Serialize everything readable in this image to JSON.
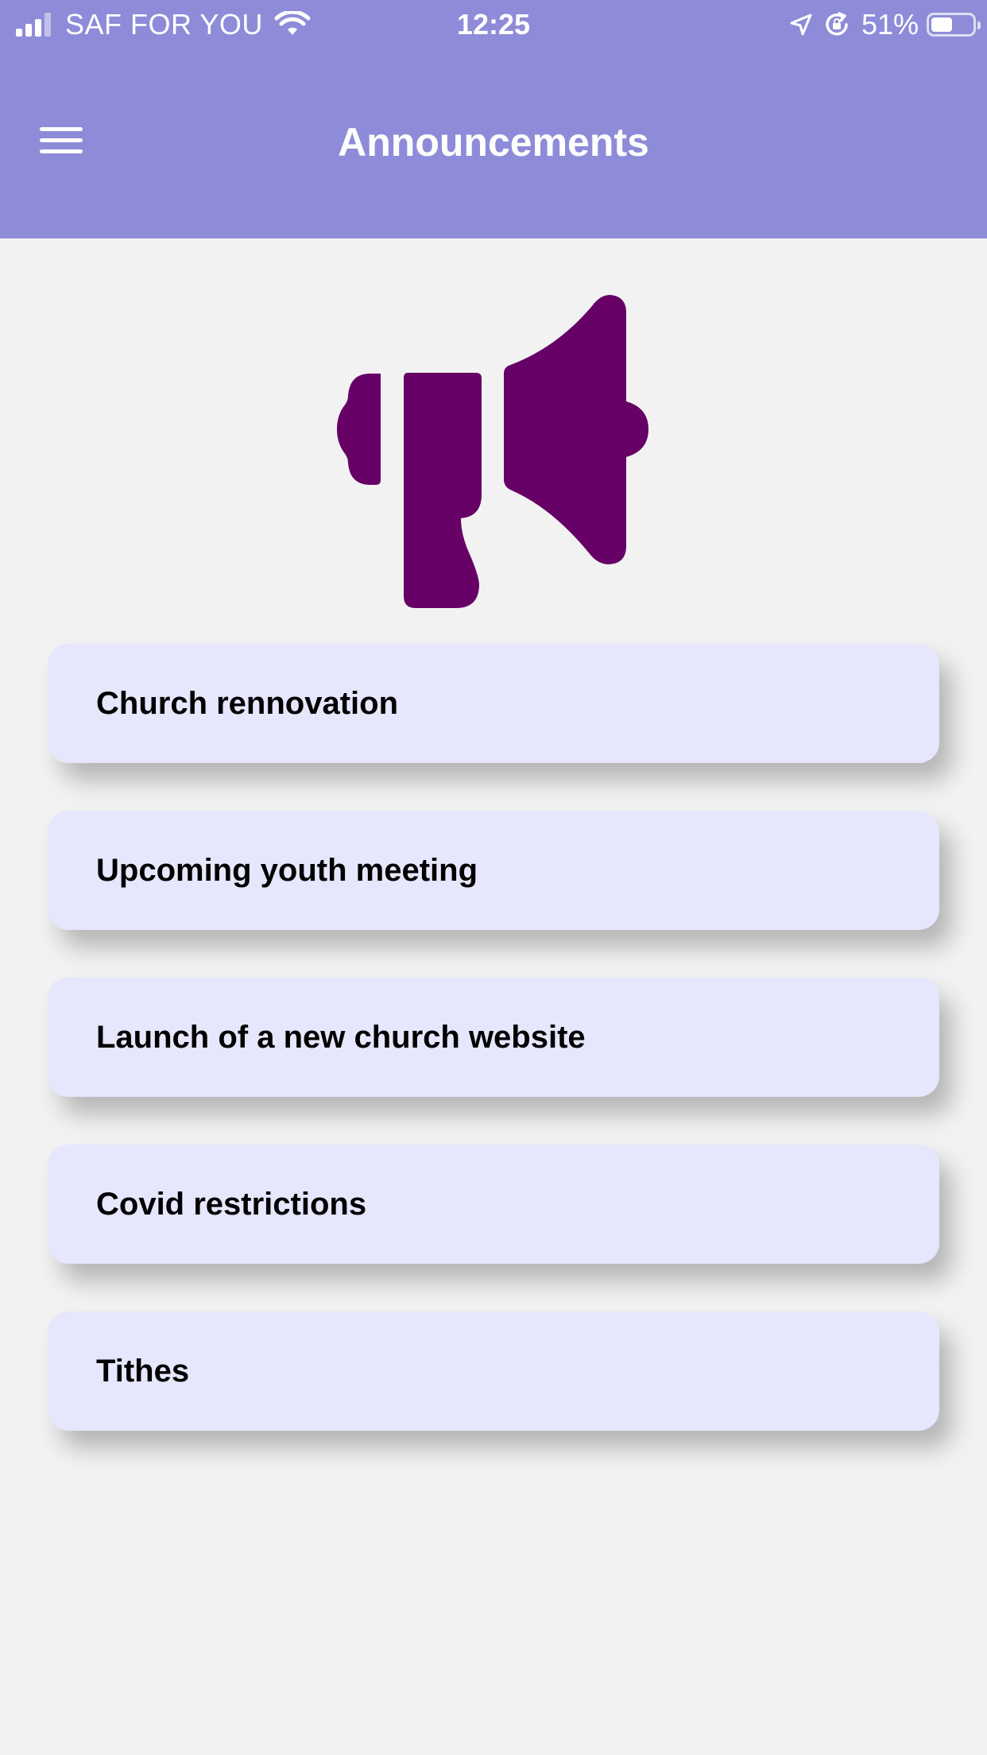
{
  "status_bar": {
    "carrier": "SAF FOR YOU",
    "time": "12:25",
    "battery_percent": "51%",
    "battery_level": 0.51
  },
  "header": {
    "title": "Announcements",
    "menu_icon": "hamburger-menu-icon"
  },
  "hero": {
    "icon": "megaphone-icon",
    "color": "#660066"
  },
  "announcements": [
    {
      "label": "Church rennovation"
    },
    {
      "label": "Upcoming youth meeting"
    },
    {
      "label": "Launch of a new church website"
    },
    {
      "label": "Covid restrictions"
    },
    {
      "label": "Tithes"
    }
  ],
  "colors": {
    "header_bg": "#8e8cd8",
    "page_bg": "#f2f2f2",
    "card_bg": "#e6e6fc",
    "accent": "#660066"
  }
}
